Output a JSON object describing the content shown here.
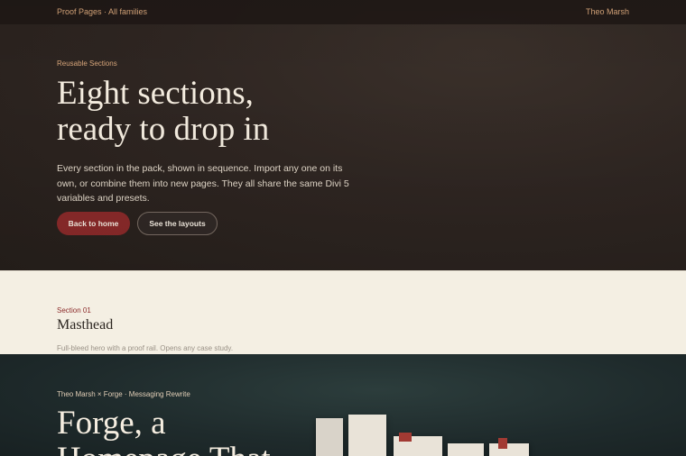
{
  "topbar": {
    "breadcrumb": "Proof Pages · All families",
    "author": "Theo Marsh"
  },
  "hero": {
    "eyebrow": "Reusable Sections",
    "title_line1": "Eight sections,",
    "title_line2": "ready to drop in",
    "description": "Every section in the pack, shown in sequence. Import any one on its own, or combine them into new pages. They all share the same Divi 5 variables and presets.",
    "primary_button": "Back to home",
    "secondary_button": "See the layouts"
  },
  "section": {
    "number": "Section 01",
    "title": "Masthead",
    "description": "Full-bleed hero with a proof rail. Opens any case study."
  },
  "case": {
    "eyebrow": "Theo Marsh × Forge · Messaging Rewrite",
    "title_line1": "Forge, a",
    "title_line2": "Homepage That"
  },
  "colors": {
    "accent": "#8b2a2a",
    "eyebrow": "#d9a77b",
    "hero_bg": "#2f2622",
    "cream": "#f4efe3"
  }
}
